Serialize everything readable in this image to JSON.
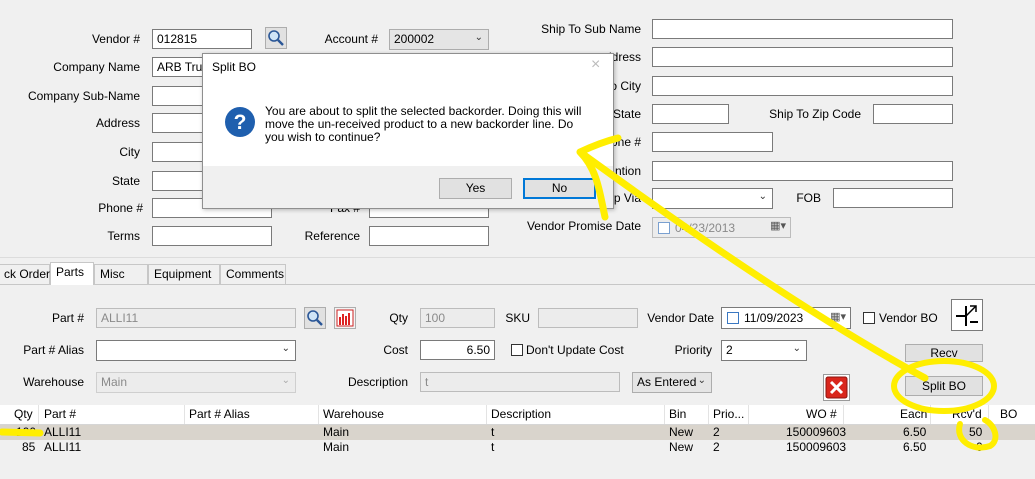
{
  "header": {
    "vendor_label": "Vendor #",
    "vendor_value": "012815",
    "account_label": "Account #",
    "account_value": "200002",
    "company_name_label": "Company Name",
    "company_name_value": "ARB Truc",
    "company_sub_name_label": "Company Sub-Name",
    "address_label": "Address",
    "city_label": "City",
    "state_label": "State",
    "phone_label": "Phone #",
    "fax_label": "Fax #",
    "terms_label": "Terms",
    "reference_label": "Reference",
    "ship_to_sub_name_label": "Ship To Sub Name",
    "ship_to_address_label": "ddress",
    "ship_to_city_label": "o City",
    "ship_to_state_label": "State",
    "ship_to_zip_label": "Ship To Zip Code",
    "ship_phone_label": "one #",
    "attention_label": "ntion",
    "ship_via_label": "ip Via",
    "fob_label": "FOB",
    "vendor_promise_date_label": "Vendor Promise Date",
    "vendor_promise_date_value": "04/23/2013"
  },
  "tabs": [
    {
      "label": "ck Order"
    },
    {
      "label": "Parts"
    },
    {
      "label": "Misc"
    },
    {
      "label": "Equipment"
    },
    {
      "label": "Comments"
    }
  ],
  "parts": {
    "part_label": "Part #",
    "part_value": "ALLI11",
    "qty_label": "Qty",
    "qty_value": "100",
    "sku_label": "SKU",
    "sku_value": "",
    "vendor_date_label": "Vendor Date",
    "vendor_date_value": "11/09/2023",
    "vendor_bo_label": "Vendor BO",
    "part_alias_label": "Part # Alias",
    "cost_label": "Cost",
    "cost_value": "6.50",
    "dont_update_cost_label": "Don't Update Cost",
    "priority_label": "Priority",
    "priority_value": "2",
    "recv_label": "Recv",
    "warehouse_label": "Warehouse",
    "warehouse_value": "Main",
    "description_label": "Description",
    "description_value": "t",
    "as_entered_value": "As Entered",
    "split_bo_label": "Split BO"
  },
  "grid": {
    "columns": [
      "Qty",
      "Part #",
      "Part # Alias",
      "Warehouse",
      "Description",
      "Bin",
      "Prio...",
      "WO #",
      "Each",
      "Rcv'd",
      "BO"
    ],
    "rows": [
      {
        "qty": "100",
        "part": "ALLI11",
        "alias": "",
        "warehouse": "Main",
        "description": "t",
        "bin": "New",
        "priority": "2",
        "wo": "150009603",
        "each": "6.50",
        "rcvd": "50",
        "bo": ""
      },
      {
        "qty": "85",
        "part": "ALLI11",
        "alias": "",
        "warehouse": "Main",
        "description": "t",
        "bin": "New",
        "priority": "2",
        "wo": "150009603",
        "each": "6.50",
        "rcvd": "0",
        "bo": ""
      }
    ]
  },
  "dialog": {
    "title": "Split BO",
    "message": "You are about to split the selected backorder.  Doing this will move the un-received product to a new backorder line.  Do you wish to continue?",
    "yes_label": "Yes",
    "no_label": "No"
  },
  "colors": {
    "annotation": "#ffee00",
    "selected_row": "#d9d4cc",
    "dialog_accent": "#0078d7",
    "question_icon": "#1f5fae",
    "delete_icon": "#d9261c"
  }
}
